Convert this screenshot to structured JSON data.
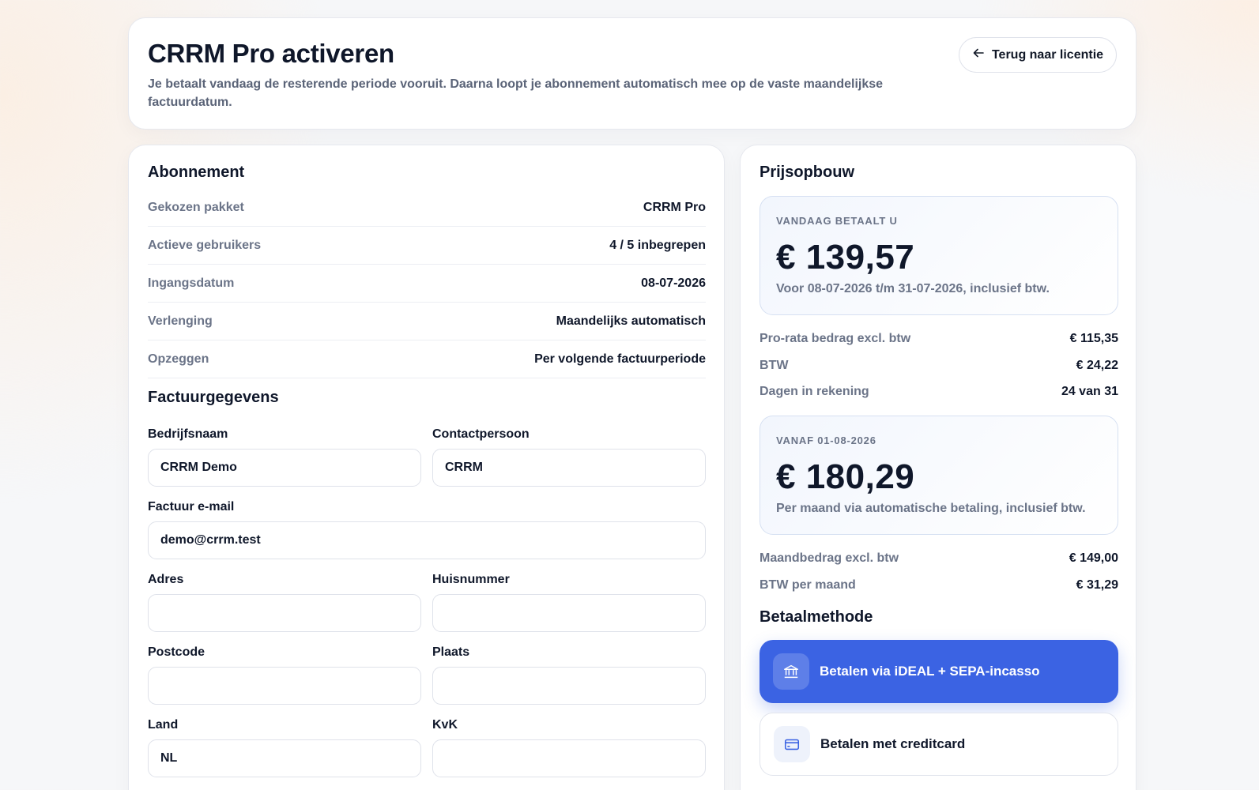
{
  "header": {
    "title": "CRRM Pro activeren",
    "subtitle": "Je betaalt vandaag de resterende periode vooruit. Daarna loopt je abonnement automatisch mee op de vaste maandelijkse factuurdatum.",
    "back_label": "Terug naar licentie"
  },
  "subscription": {
    "title": "Abonnement",
    "rows": [
      {
        "label": "Gekozen pakket",
        "value": "CRRM Pro"
      },
      {
        "label": "Actieve gebruikers",
        "value": "4 / 5 inbegrepen"
      },
      {
        "label": "Ingangsdatum",
        "value": "08-07-2026"
      },
      {
        "label": "Verlenging",
        "value": "Maandelijks automatisch"
      },
      {
        "label": "Opzeggen",
        "value": "Per volgende factuurperiode"
      }
    ]
  },
  "billing": {
    "title": "Factuurgegevens",
    "company": {
      "label": "Bedrijfsnaam",
      "value": "CRRM Demo"
    },
    "contact": {
      "label": "Contactpersoon",
      "value": "CRRM"
    },
    "email": {
      "label": "Factuur e-mail",
      "value": "demo@crrm.test"
    },
    "address": {
      "label": "Adres",
      "value": ""
    },
    "house_number": {
      "label": "Huisnummer",
      "value": ""
    },
    "postcode": {
      "label": "Postcode",
      "value": ""
    },
    "city": {
      "label": "Plaats",
      "value": ""
    },
    "country": {
      "label": "Land",
      "value": "NL"
    },
    "kvk": {
      "label": "KvK",
      "value": ""
    }
  },
  "pricing": {
    "title": "Prijsopbouw",
    "today": {
      "eyebrow": "VANDAAG BETAALT U",
      "amount": "€ 139,57",
      "note": "Voor 08-07-2026 t/m 31-07-2026, inclusief btw."
    },
    "today_rows": [
      {
        "label": "Pro-rata bedrag excl. btw",
        "value": "€ 115,35"
      },
      {
        "label": "BTW",
        "value": "€ 24,22"
      },
      {
        "label": "Dagen in rekening",
        "value": "24 van 31"
      }
    ],
    "monthly": {
      "eyebrow": "VANAF 01-08-2026",
      "amount": "€ 180,29",
      "note": "Per maand via automatische betaling, inclusief btw."
    },
    "monthly_rows": [
      {
        "label": "Maandbedrag excl. btw",
        "value": "€ 149,00"
      },
      {
        "label": "BTW per maand",
        "value": "€ 31,29"
      }
    ]
  },
  "payment": {
    "title": "Betaalmethode",
    "options": [
      {
        "label": "Betalen via iDEAL + SEPA-incasso",
        "icon": "bank-icon",
        "selected": true
      },
      {
        "label": "Betalen met creditcard",
        "icon": "credit-card-icon",
        "selected": false
      }
    ]
  },
  "colors": {
    "accent": "#3b63e3",
    "muted_text": "#6b7488",
    "primary_text": "#0f172a"
  }
}
